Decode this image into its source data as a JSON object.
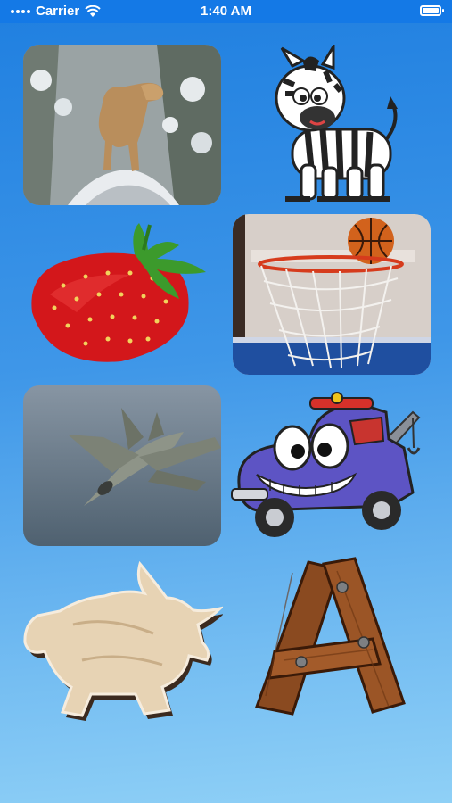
{
  "status_bar": {
    "carrier": "Carrier",
    "time": "1:40 AM",
    "icons": [
      "signal-dots",
      "wifi-icon",
      "battery-icon"
    ]
  },
  "tiles": [
    {
      "picture": "cougar-icon"
    },
    {
      "picture": "zebra-icon"
    },
    {
      "picture": "strawberry-icon"
    },
    {
      "picture": "basketball-hoop-icon"
    },
    {
      "picture": "fighter-jet-icon"
    },
    {
      "picture": "tow-truck-icon"
    },
    {
      "picture": "bull-puzzle-icon"
    },
    {
      "picture": "wooden-letter-icon"
    }
  ],
  "colors": {
    "status_bar": "#1479e6",
    "background_top": "#1f7fe0",
    "background_bottom": "#8fd0f6"
  }
}
